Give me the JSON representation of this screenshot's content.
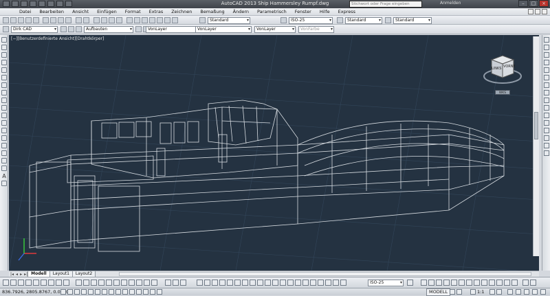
{
  "window": {
    "app_title": "AutoCAD 2013    Ship Hammersley Rumpf.dwg",
    "search_placeholder": "Stichwort oder Frage eingeben",
    "login_label": "Anmelden"
  },
  "menu": [
    "Datei",
    "Bearbeiten",
    "Ansicht",
    "Einfügen",
    "Format",
    "Extras",
    "Zeichnen",
    "Bemaßung",
    "Ändern",
    "Parametrisch",
    "Fenster",
    "Hilfe",
    "Express"
  ],
  "toolbar1": {
    "text_style": "Standard",
    "dim_style": "ISO-25",
    "table_style": "Standard",
    "mleader_style": "Standard"
  },
  "toolbar2": {
    "workspace": "Dirk CAD",
    "layer": "Aufbauten",
    "color": "VonLayer",
    "linetype": "VonLayer",
    "lineweight": "VonLayer",
    "plotstyle": "VonFarbe"
  },
  "viewport": {
    "label": "[−][Benutzerdefinierte Ansicht][Drahtkörper]",
    "viewcube_faces": [
      "LINKS",
      "VORNE"
    ],
    "wcs_label": "WKS",
    "background": "#243241",
    "wire_color": "#d8dde2",
    "grid_color": "#33465a"
  },
  "layout_tabs": [
    {
      "label": "Modell",
      "active": true
    },
    {
      "label": "Layout1",
      "active": false
    },
    {
      "label": "Layout2",
      "active": false
    }
  ],
  "bottom_toolbar": {
    "dim_style": "ISO-25"
  },
  "status": {
    "coordinates": "836.7926,  2805.8767, 0.0000",
    "model_button": "MODELL",
    "scale": "1:1"
  }
}
